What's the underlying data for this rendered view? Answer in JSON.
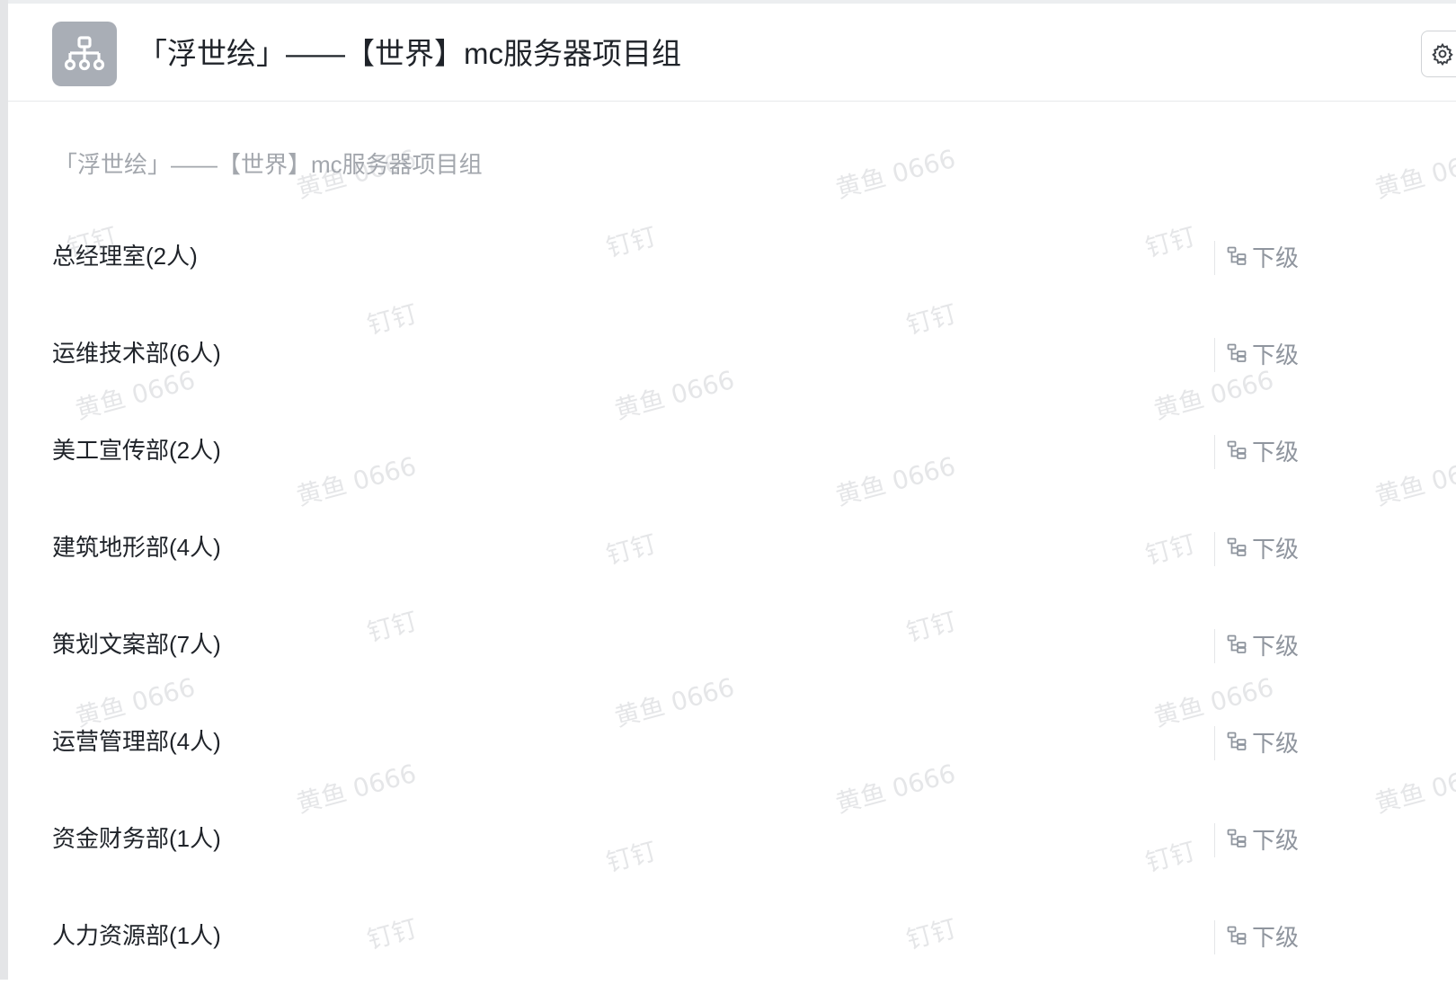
{
  "header": {
    "title": "「浮世绘」——【世界】mc服务器项目组",
    "avatar_icon": "org-chart-icon",
    "settings_icon": "gear-icon"
  },
  "breadcrumb": "「浮世绘」——【世界】mc服务器项目组",
  "departments": [
    {
      "name": "总经理室(2人)",
      "sub_label": "下级"
    },
    {
      "name": "运维技术部(6人)",
      "sub_label": "下级"
    },
    {
      "name": "美工宣传部(2人)",
      "sub_label": "下级"
    },
    {
      "name": "建筑地形部(4人)",
      "sub_label": "下级"
    },
    {
      "name": "策划文案部(7人)",
      "sub_label": "下级"
    },
    {
      "name": "运营管理部(4人)",
      "sub_label": "下级"
    },
    {
      "name": "资金财务部(1人)",
      "sub_label": "下级"
    },
    {
      "name": "人力资源部(1人)",
      "sub_label": "下级"
    }
  ],
  "watermark": {
    "name_text": "黄鱼 0666",
    "app_text": "钉钉"
  },
  "colors": {
    "avatar_bg": "#a9aeb6",
    "text_primary": "#1f2329",
    "text_muted": "#8f959e"
  }
}
